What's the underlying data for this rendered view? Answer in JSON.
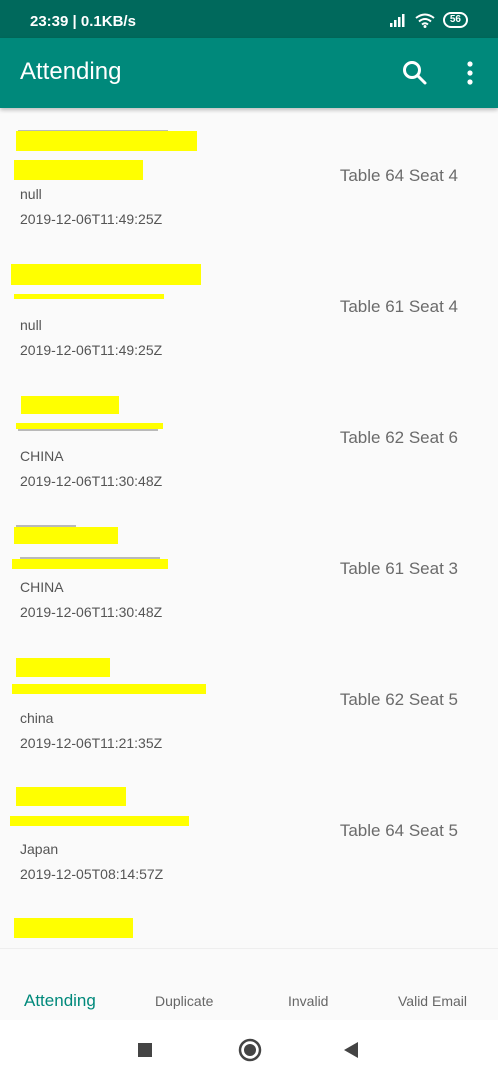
{
  "status_bar": {
    "time_speed": "23:39 | 0.1KB/s",
    "battery": "56",
    "icons": [
      "signal-icon",
      "wifi-icon",
      "battery-icon"
    ]
  },
  "app_bar": {
    "title": "Attending",
    "actions": [
      "search-icon",
      "more-vert-icon"
    ]
  },
  "attendees": [
    {
      "country": "null",
      "timestamp": "2019-12-06T11:49:25Z",
      "seat": "Table 64 Seat 4"
    },
    {
      "country": "null",
      "timestamp": "2019-12-06T11:49:25Z",
      "seat": "Table 61 Seat 4"
    },
    {
      "country": "CHINA",
      "timestamp": "2019-12-06T11:30:48Z",
      "seat": "Table 62 Seat 6"
    },
    {
      "country": "CHINA",
      "timestamp": "2019-12-06T11:30:48Z",
      "seat": "Table 61 Seat 3"
    },
    {
      "country": "china",
      "timestamp": "2019-12-06T11:21:35Z",
      "seat": "Table 62 Seat 5"
    },
    {
      "country": "Japan",
      "timestamp": "2019-12-05T08:14:57Z",
      "seat": "Table 64 Seat 5"
    }
  ],
  "tabs": [
    "Attending",
    "Duplicate",
    "Invalid",
    "Valid Email"
  ],
  "colors": {
    "status_bar": "#00695c",
    "app_bar": "#00897b",
    "active_tab": "#00897b",
    "redaction": "#ffff00"
  }
}
